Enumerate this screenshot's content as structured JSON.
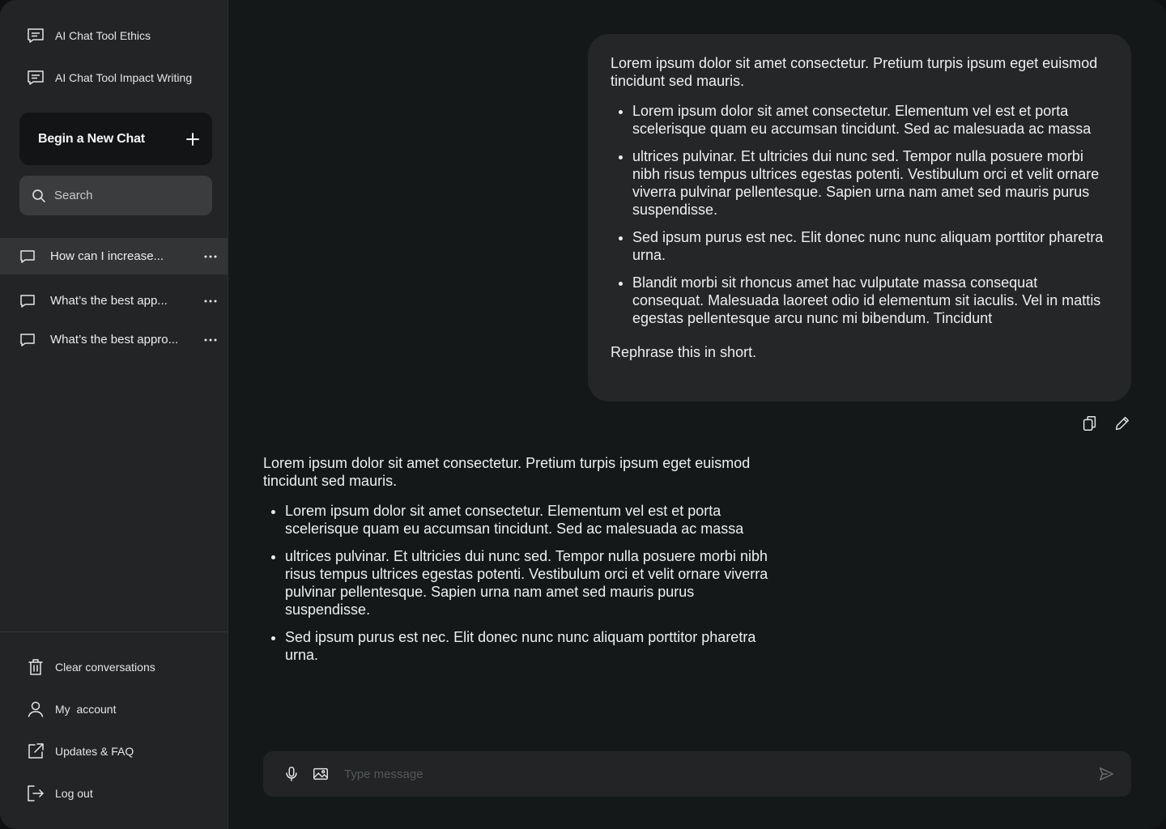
{
  "sidebar": {
    "pinned": [
      {
        "label": "AI Chat Tool Ethics",
        "icon": "chat-lines-icon"
      },
      {
        "label": "AI Chat Tool Impact Writing",
        "icon": "chat-lines-icon"
      }
    ],
    "new_chat_label": "Begin a New Chat",
    "search_placeholder": "Search",
    "history": [
      {
        "label": "How can I increase...",
        "active": true
      },
      {
        "label": "What’s the best app...",
        "active": false
      },
      {
        "label": "What’s the best appro...",
        "active": false
      }
    ],
    "bottom": [
      {
        "label": "Clear conversations",
        "icon": "trash-icon"
      },
      {
        "label": "My  account",
        "icon": "user-icon"
      },
      {
        "label": "Updates & FAQ",
        "icon": "external-link-icon"
      },
      {
        "label": "Log out",
        "icon": "logout-icon"
      }
    ]
  },
  "conversation": {
    "user_message": {
      "intro": "Lorem ipsum dolor sit amet consectetur. Pretium turpis ipsum eget euismod tincidunt sed mauris.",
      "bullets": [
        "Lorem ipsum dolor sit amet consectetur. Elementum vel est et porta scelerisque quam eu accumsan tincidunt. Sed ac malesuada ac massa",
        "ultrices pulvinar. Et ultricies dui nunc sed. Tempor nulla posuere morbi nibh risus tempus ultrices egestas potenti. Vestibulum orci et velit ornare viverra pulvinar pellentesque. Sapien urna nam amet sed mauris purus suspendisse.",
        "Sed ipsum purus est nec. Elit donec nunc nunc aliquam porttitor pharetra urna.",
        "Blandit morbi sit rhoncus amet hac vulputate massa consequat consequat. Malesuada laoreet odio id elementum sit iaculis. Vel in mattis egestas pellentesque arcu nunc mi bibendum. Tincidunt"
      ],
      "ask": "Rephrase this in short."
    },
    "assistant_message": {
      "intro": "Lorem ipsum dolor sit amet consectetur. Pretium turpis ipsum eget euismod tincidunt sed mauris.",
      "bullets": [
        "Lorem ipsum dolor sit amet consectetur. Elementum vel est et porta scelerisque quam eu accumsan tincidunt. Sed ac malesuada ac massa",
        "ultrices pulvinar. Et ultricies dui nunc sed. Tempor nulla posuere morbi nibh risus tempus ultrices egestas potenti. Vestibulum orci et velit ornare viverra pulvinar pellentesque. Sapien urna nam amet sed mauris purus suspendisse.",
        "Sed ipsum purus est nec. Elit donec nunc nunc aliquam porttitor pharetra urna."
      ]
    }
  },
  "composer": {
    "placeholder": "Type message"
  },
  "colors": {
    "sidebar_bg": "#222425",
    "main_bg": "#151819",
    "bubble_bg": "#242627",
    "active_item_bg": "#323435"
  }
}
